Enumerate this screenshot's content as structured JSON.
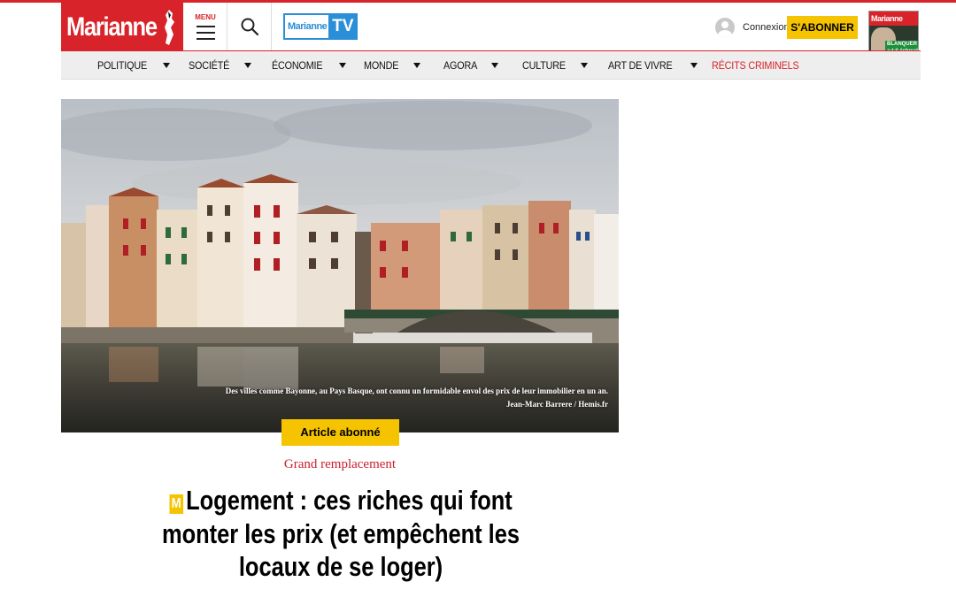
{
  "header": {
    "logo_text": "Marianne",
    "menu_label": "MENU",
    "tv_logo_left": "Marianne",
    "tv_logo_right": "TV",
    "connexion_label": "Connexion",
    "subscribe_label": "S'ABONNER",
    "magazine": {
      "masthead": "Marianne",
      "headline": "BLANQUER a-t-il échoué ?"
    }
  },
  "nav": {
    "items": [
      {
        "label": "POLITIQUE",
        "has_dropdown": true
      },
      {
        "label": "SOCIÉTÉ",
        "has_dropdown": true
      },
      {
        "label": "ÉCONOMIE",
        "has_dropdown": true
      },
      {
        "label": "MONDE",
        "has_dropdown": true
      },
      {
        "label": "AGORA",
        "has_dropdown": true
      },
      {
        "label": "CULTURE",
        "has_dropdown": true
      },
      {
        "label": "ART DE VIVRE",
        "has_dropdown": true
      },
      {
        "label": "RÉCITS CRIMINELS",
        "has_dropdown": false
      }
    ]
  },
  "article": {
    "image_caption": "Des villes comme Bayonne, au Pays Basque, ont connu un formidable envol des prix de leur immobilier en un an.",
    "image_credit": "Jean-Marc Barrere / Hemis.fr",
    "badge": "Article abonné",
    "section": "Grand remplacement",
    "premium_marker": "M",
    "title": "Logement : ces riches qui font monter les prix (et empêchent les locaux de se loger)"
  },
  "colors": {
    "brand_red": "#d8232a",
    "accent_yellow": "#f5c300",
    "tv_blue": "#2a8fd6",
    "nav_bg": "#eeeeee",
    "section_red": "#c8202c"
  }
}
